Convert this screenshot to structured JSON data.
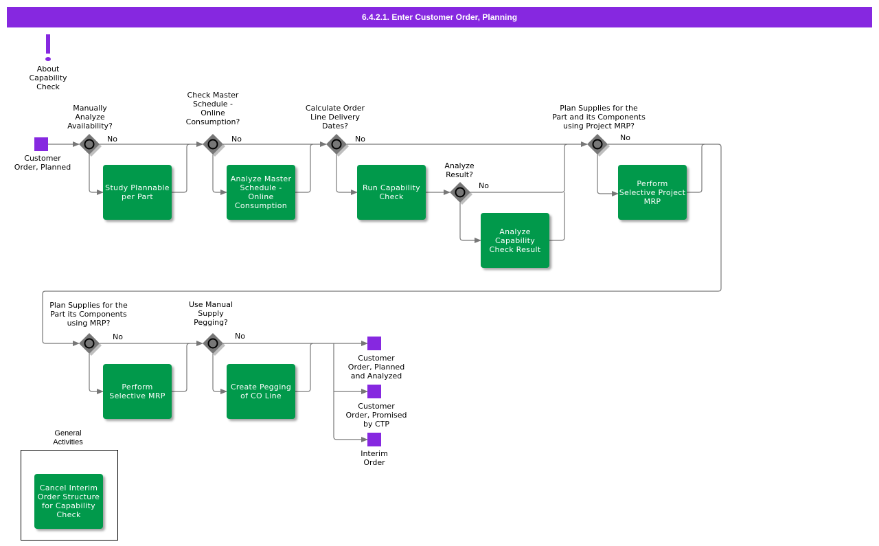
{
  "title": "6.4.2.1. Enter Customer Order, Planning",
  "colors": {
    "header": "#8628e0",
    "task": "#01994b",
    "event": "#8628e0",
    "gateway": "#777777",
    "line": "#777777"
  },
  "annotation": {
    "icon": "exclamation-icon",
    "label": "About\nCapability\nCheck"
  },
  "events": {
    "start": "Customer\nOrder, Planned",
    "end1": "Customer\nOrder, Planned\nand Analyzed",
    "end2": "Customer\nOrder, Promised\nby CTP",
    "end3": "Interim\nOrder"
  },
  "gateways": {
    "g1": {
      "question": "Manually\nAnalyze\nAvailability?",
      "no_label": "No"
    },
    "g2": {
      "question": "Check Master\nSchedule -\nOnline\nConsumption?",
      "no_label": "No"
    },
    "g3": {
      "question": "Calculate Order\nLine Delivery\nDates?",
      "no_label": "No"
    },
    "g4": {
      "question": "Analyze\nResult?",
      "no_label": "No"
    },
    "g5": {
      "question": "Plan Supplies for the\nPart and its Components\nusing Project MRP?",
      "no_label": "No"
    },
    "g6": {
      "question": "Plan Supplies for the\nPart its Components\nusing MRP?",
      "no_label": "No"
    },
    "g7": {
      "question": "Use Manual\nSupply\nPegging?",
      "no_label": "No"
    }
  },
  "tasks": {
    "t1": "Study Plannable\nper Part",
    "t2": "Analyze Master\nSchedule -\nOnline\nConsumption",
    "t3": "Run Capability\nCheck",
    "t4": "Analyze\nCapability\nCheck Result",
    "t5": "Perform\nSelective Project\nMRP",
    "t6": "Perform\nSelective MRP",
    "t7": "Create Pegging\nof CO Line",
    "t8": "Cancel Interim\nOrder Structure\nfor Capability\nCheck"
  },
  "group": {
    "label": "General\nActivities"
  }
}
